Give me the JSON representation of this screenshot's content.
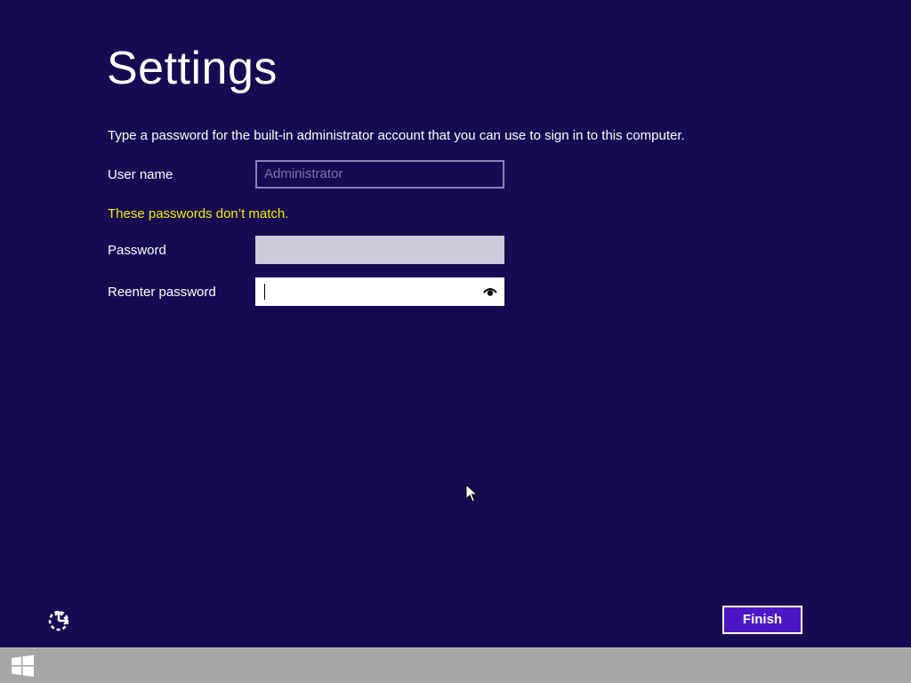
{
  "page": {
    "title": "Settings",
    "instruction": "Type a password for the built-in administrator account that you can use to sign in to this computer."
  },
  "form": {
    "username_label": "User name",
    "username_placeholder": "Administrator",
    "error_message": "These passwords don’t match.",
    "password_label": "Password",
    "password_value": "",
    "reenter_label": "Reenter password",
    "reenter_value": ""
  },
  "footer": {
    "finish_label": "Finish",
    "ease_of_access_icon": "ease-of-access-icon"
  },
  "taskbar": {
    "start_icon": "windows-logo-icon"
  },
  "colors": {
    "background": "#180a52",
    "error": "#f4f000",
    "accent_button": "#4b17c4",
    "taskbar": "#a6a6a6"
  }
}
